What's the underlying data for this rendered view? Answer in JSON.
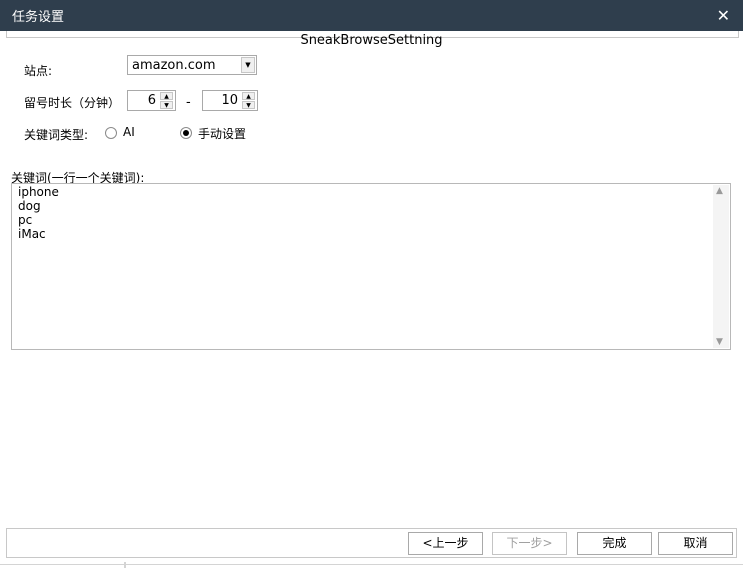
{
  "window": {
    "title": "任务设置",
    "close_icon": "close-icon"
  },
  "subtitle": "SneakBrowseSettning",
  "site": {
    "label": "站点:",
    "value": "amazon.com"
  },
  "duration": {
    "label": "留号时长（分钟）",
    "min_value": "6",
    "max_value": "10",
    "separator": "-"
  },
  "keyword_type": {
    "label": "关键词类型:",
    "options": [
      {
        "label": "AI",
        "selected": false
      },
      {
        "label": "手动设置",
        "selected": true
      }
    ]
  },
  "keywords": {
    "label": "关键词(一行一个关键词):",
    "items": [
      "iphone",
      "dog",
      "pc",
      "iMac"
    ]
  },
  "buttons": {
    "prev": "<上一步",
    "next": "下一步>",
    "finish": "完成",
    "cancel": "取消"
  }
}
